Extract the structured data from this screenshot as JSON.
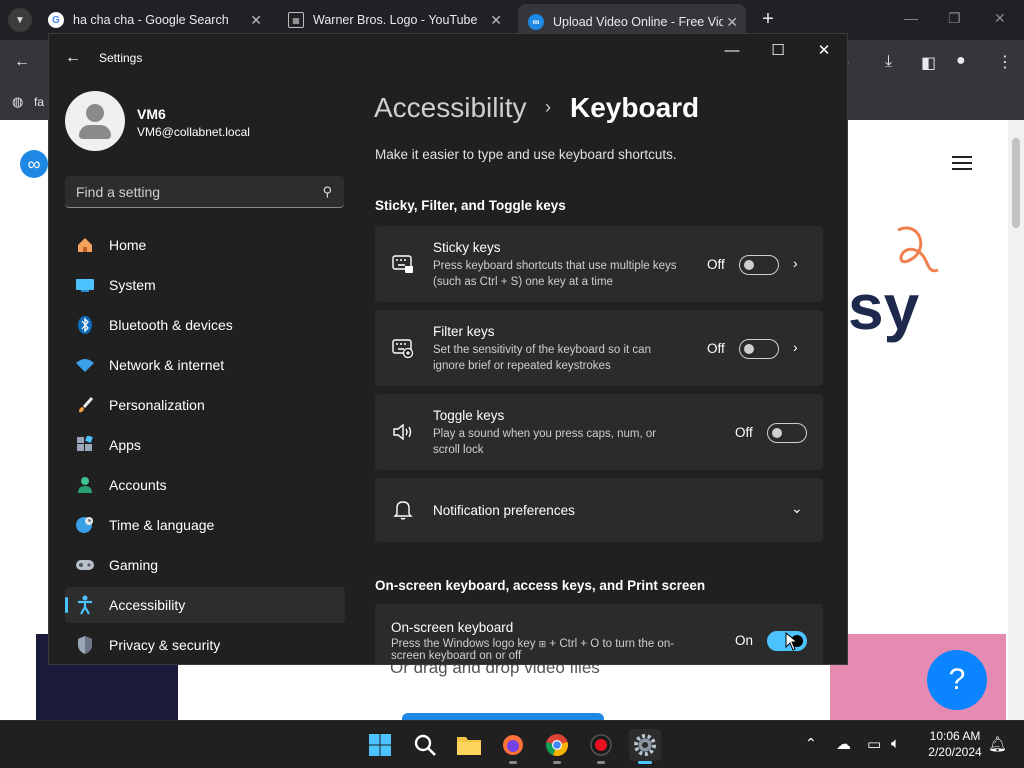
{
  "browser": {
    "tabs": [
      {
        "title": "ha cha cha - Google Search",
        "icon": "google-icon"
      },
      {
        "title": "Warner Bros. Logo - YouTube",
        "icon": "broken-image-icon"
      },
      {
        "title": "Upload Video Online - Free Video",
        "icon": "infinity-logo-icon"
      }
    ],
    "bookmark_label": "fa",
    "page": {
      "headline_fragment": "sy",
      "upload_hint": "Or drag and drop video files",
      "help_label": "?"
    }
  },
  "settings": {
    "window_title": "Settings",
    "user": {
      "name": "VM6",
      "email": "VM6@collabnet.local"
    },
    "search": {
      "placeholder": "Find a setting"
    },
    "nav": [
      {
        "label": "Home",
        "icon": "home-icon"
      },
      {
        "label": "System",
        "icon": "system-icon"
      },
      {
        "label": "Bluetooth & devices",
        "icon": "bluetooth-icon"
      },
      {
        "label": "Network & internet",
        "icon": "wifi-icon"
      },
      {
        "label": "Personalization",
        "icon": "brush-icon"
      },
      {
        "label": "Apps",
        "icon": "apps-icon"
      },
      {
        "label": "Accounts",
        "icon": "accounts-icon"
      },
      {
        "label": "Time & language",
        "icon": "globe-clock-icon"
      },
      {
        "label": "Gaming",
        "icon": "gamepad-icon"
      },
      {
        "label": "Accessibility",
        "icon": "accessibility-icon",
        "selected": true
      },
      {
        "label": "Privacy & security",
        "icon": "shield-icon"
      }
    ],
    "breadcrumb": {
      "parent": "Accessibility",
      "separator": "›",
      "current": "Keyboard"
    },
    "description": "Make it easier to type and use keyboard shortcuts.",
    "section1": "Sticky, Filter, and Toggle keys",
    "section2": "On-screen keyboard, access keys, and Print screen",
    "cards": {
      "sticky": {
        "title": "Sticky keys",
        "desc": "Press keyboard shortcuts that use multiple keys (such as Ctrl + S) one key at a time",
        "state": "Off",
        "on": false
      },
      "filter": {
        "title": "Filter keys",
        "desc": "Set the sensitivity of the keyboard so it can ignore brief or repeated keystrokes",
        "state": "Off",
        "on": false
      },
      "toggle": {
        "title": "Toggle keys",
        "desc": "Play a sound when you press caps, num, or scroll lock",
        "state": "Off",
        "on": false
      },
      "notifications": {
        "title": "Notification preferences"
      },
      "onscreen": {
        "title": "On-screen keyboard",
        "desc_before": "Press the Windows logo key",
        "desc_after": "+ Ctrl + O to turn the on-screen keyboard on or off",
        "state": "On",
        "on": true
      }
    }
  },
  "taskbar": {
    "apps": [
      "windows-start-icon",
      "search-icon",
      "file-explorer-icon",
      "firefox-icon",
      "chrome-icon",
      "recorder-icon",
      "settings-gear-icon"
    ],
    "time": "10:06 AM",
    "date": "2/20/2024"
  },
  "colors": {
    "accent": "#4cc2ff",
    "window_bg": "#202020",
    "card_bg": "#2b2b2b",
    "help_button": "#0a84ff"
  }
}
